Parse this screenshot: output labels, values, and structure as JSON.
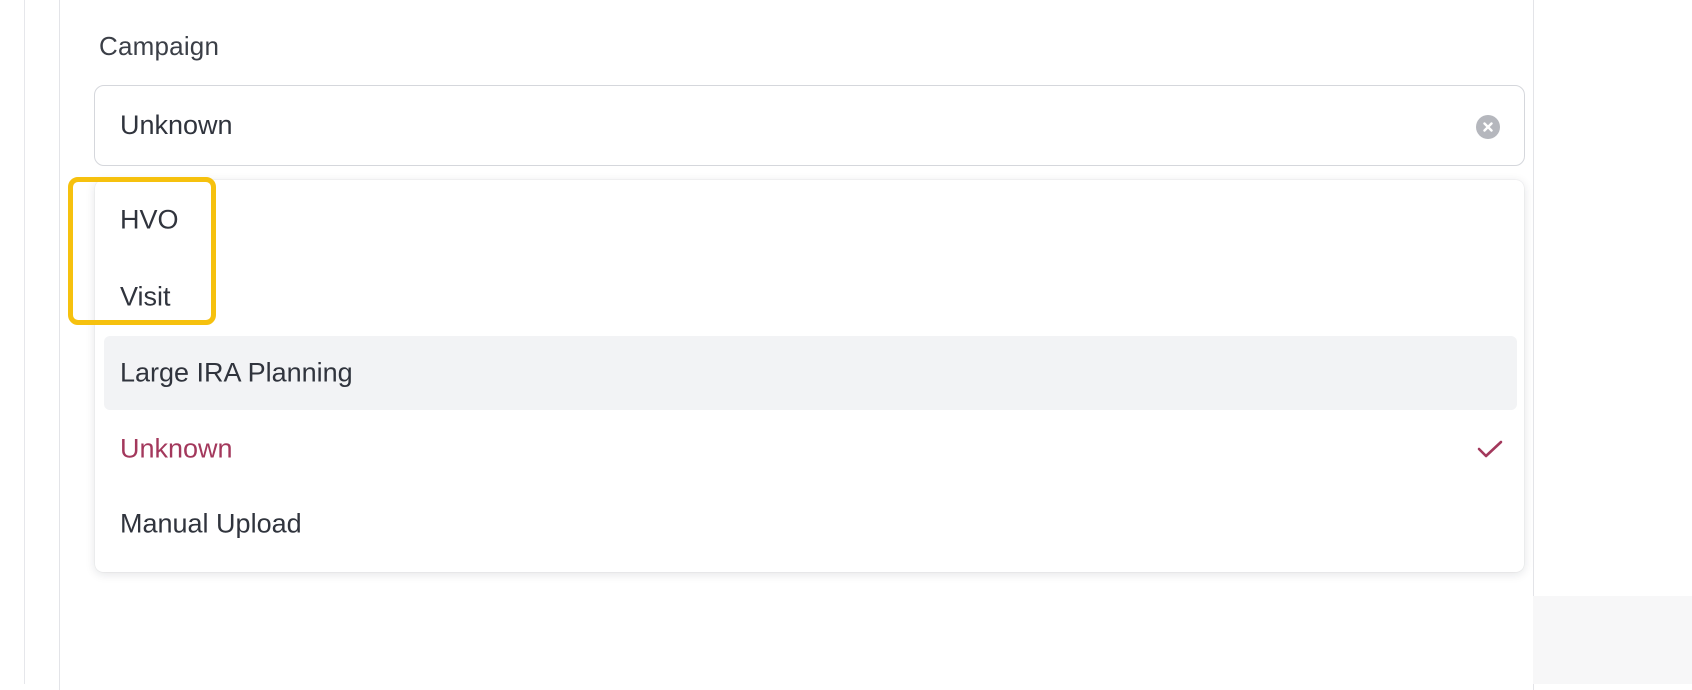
{
  "campaign_field": {
    "label": "Campaign",
    "value": "Unknown",
    "clear_icon": "clear-circle-icon"
  },
  "dropdown": {
    "options": [
      {
        "label": "HVO"
      },
      {
        "label": "Visit"
      },
      {
        "label": "Large IRA Planning",
        "state": "hovered"
      },
      {
        "label": "Unknown",
        "state": "selected"
      },
      {
        "label": "Manual Upload"
      }
    ],
    "check_icon": "checkmark-icon"
  },
  "colors": {
    "selected_text": "#a3385c",
    "hover_background": "#f2f3f5",
    "highlight_box": "#f6c10e"
  }
}
